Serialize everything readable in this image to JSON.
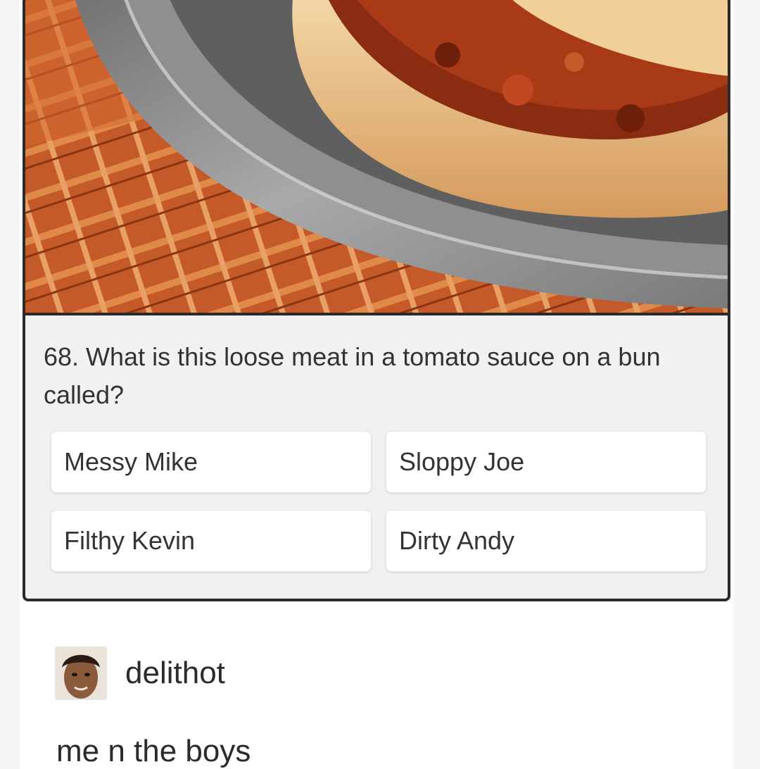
{
  "quiz": {
    "question": "68. What is this loose meat in a tomato sauce on a bun called?",
    "answers": [
      "Messy Mike",
      "Sloppy Joe",
      "Filthy Kevin",
      "Dirty Andy"
    ]
  },
  "post": {
    "username": "delithot",
    "text": "me n the boys"
  },
  "colors": {
    "card_border": "#2b2b2b",
    "card_background": "#f1f1f1",
    "answer_background": "#ffffff",
    "text": "#333333"
  }
}
